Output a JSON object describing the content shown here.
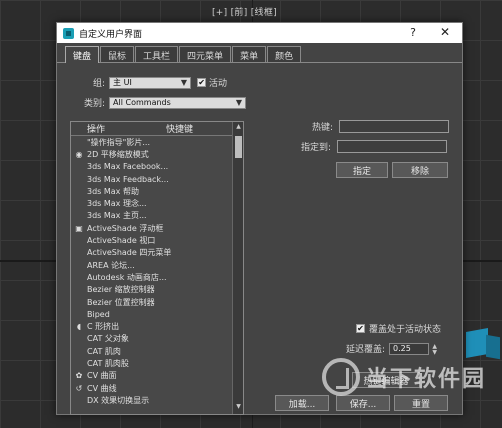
{
  "viewport": {
    "label": "[+] [前] [线框]"
  },
  "dialog": {
    "title": "自定义用户界面",
    "help": "?",
    "close": "✕",
    "tabs": [
      "键盘",
      "鼠标",
      "工具栏",
      "四元菜单",
      "菜单",
      "颜色"
    ],
    "group_label": "组:",
    "group_value": "主 UI",
    "active_checkbox_label": "活动",
    "active_checked": true,
    "category_label": "类别:",
    "category_value": "All Commands",
    "list": {
      "header_action": "操作",
      "header_hotkey": "快捷键",
      "items": [
        {
          "icon": "",
          "text": "\"操作指导\"影片..."
        },
        {
          "icon": "camera-icon",
          "glyph": "◉",
          "text": "2D 平移缩放模式"
        },
        {
          "icon": "",
          "text": "3ds Max Facebook..."
        },
        {
          "icon": "",
          "text": "3ds Max Feedback..."
        },
        {
          "icon": "",
          "text": "3ds Max 帮助"
        },
        {
          "icon": "",
          "text": "3ds Max 理念..."
        },
        {
          "icon": "",
          "text": "3ds Max 主页..."
        },
        {
          "icon": "activeshade-icon",
          "glyph": "▣",
          "text": "ActiveShade 浮动框"
        },
        {
          "icon": "",
          "text": "ActiveShade 视口"
        },
        {
          "icon": "",
          "text": "ActiveShade 四元菜单"
        },
        {
          "icon": "",
          "text": "AREA 论坛..."
        },
        {
          "icon": "",
          "text": "Autodesk 动画商店..."
        },
        {
          "icon": "",
          "text": "Bezier 缩放控制器"
        },
        {
          "icon": "",
          "text": "Bezier 位置控制器"
        },
        {
          "icon": "",
          "text": "Biped"
        },
        {
          "icon": "c-extrude-icon",
          "glyph": "◖",
          "text": "C 形挤出"
        },
        {
          "icon": "",
          "text": "CAT 父对象"
        },
        {
          "icon": "",
          "text": "CAT 肌肉"
        },
        {
          "icon": "",
          "text": "CAT 肌肉股"
        },
        {
          "icon": "cv-surface-icon",
          "glyph": "✿",
          "text": "CV 曲面"
        },
        {
          "icon": "cv-curve-icon",
          "glyph": "↺",
          "text": "CV 曲线"
        },
        {
          "icon": "",
          "text": "DX 效果切换显示"
        }
      ]
    },
    "hotkey_label": "热键:",
    "hotkey_value": "",
    "assigned_label": "指定到:",
    "assigned_value": "",
    "assign_button": "指定",
    "remove_button": "移除",
    "override_label": "覆盖处于活动状态",
    "override_checked": true,
    "delay_label": "延迟覆盖:",
    "delay_value": "0.25",
    "hotkey_editor_button": "热键编辑器",
    "load_button": "加载...",
    "save_button": "保存...",
    "reset_button": "重置"
  },
  "watermark": {
    "text": "当下软件园"
  }
}
